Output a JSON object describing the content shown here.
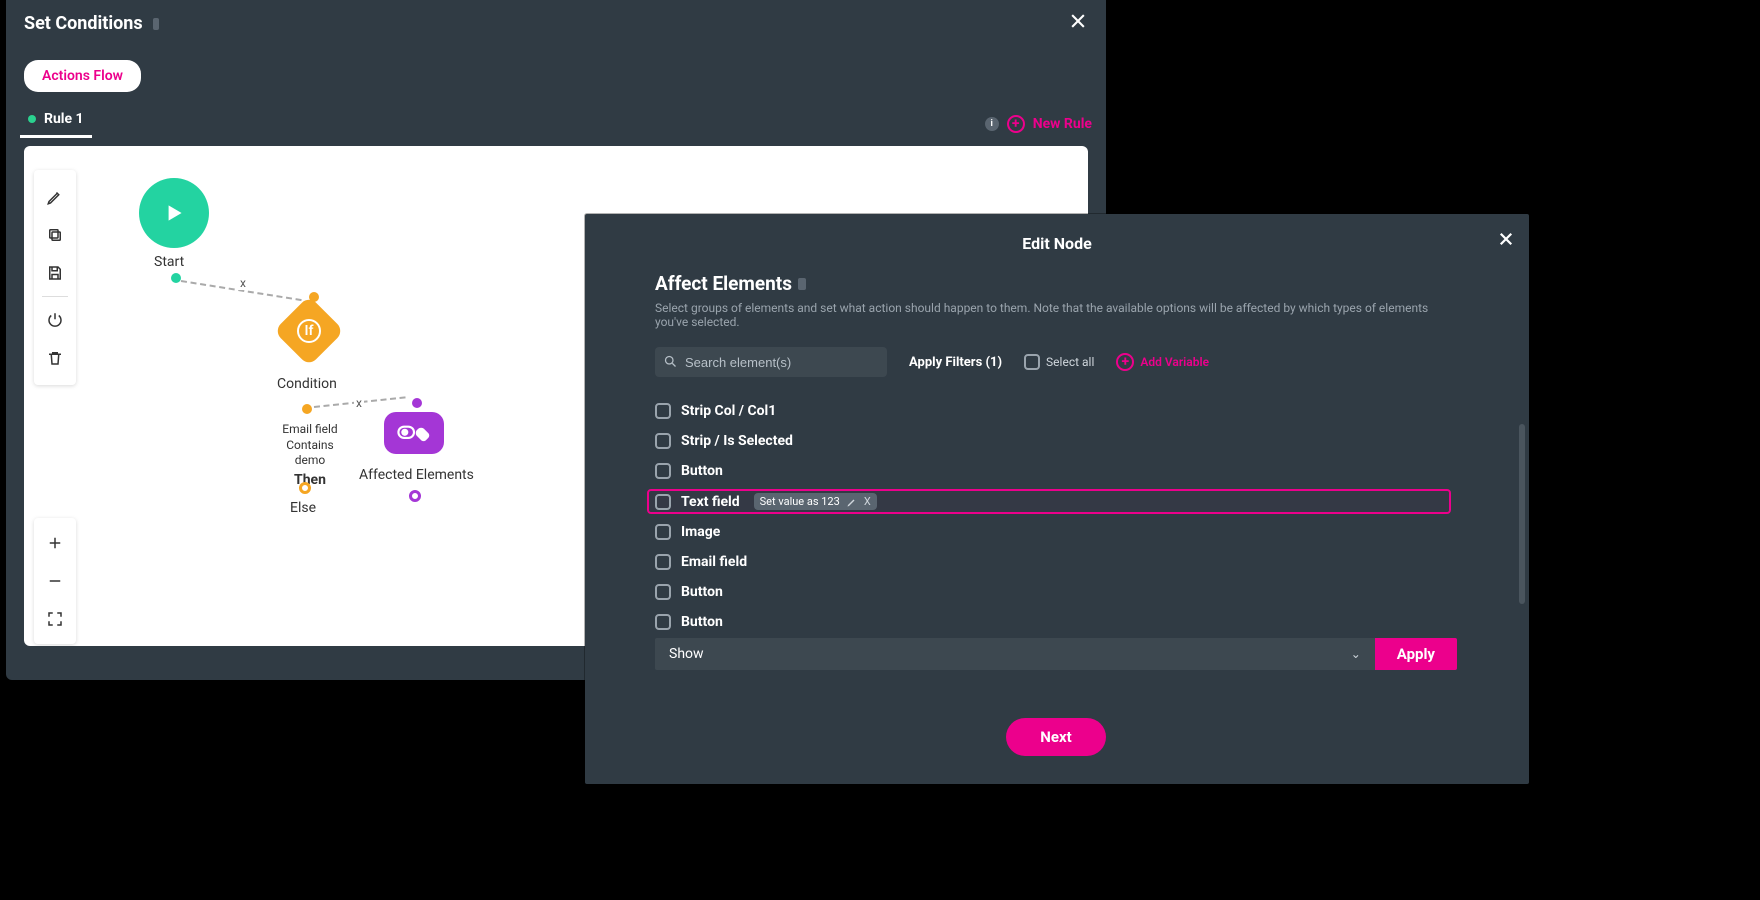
{
  "setConditions": {
    "title": "Set Conditions",
    "actionsFlow": "Actions Flow",
    "rule1": "Rule 1",
    "newRule": "New Rule",
    "flow": {
      "start": "Start",
      "condition": "Condition",
      "if": "If",
      "thenLine1": "Email field",
      "thenLine2": "Contains demo",
      "then": "Then",
      "else": "Else",
      "affected": "Affected Elements",
      "x": "x"
    }
  },
  "editNode": {
    "title": "Edit Node",
    "sectionTitle": "Affect Elements",
    "description": "Select groups of elements and set what action should happen to them. Note that the available options will be affected by which types of elements you've selected.",
    "searchPlaceholder": "Search element(s)",
    "applyFilters": "Apply Filters (1)",
    "selectAll": "Select all",
    "addVariable": "Add Variable",
    "elements": [
      {
        "label": "Strip Col / Col1"
      },
      {
        "label": "Strip / Is Selected"
      },
      {
        "label": "Button"
      },
      {
        "label": "Text field",
        "highlight": true,
        "chip": "Set value as 123"
      },
      {
        "label": "Image"
      },
      {
        "label": "Email field"
      },
      {
        "label": "Button"
      },
      {
        "label": "Button"
      }
    ],
    "actionSelect": "Show",
    "apply": "Apply",
    "next": "Next"
  }
}
